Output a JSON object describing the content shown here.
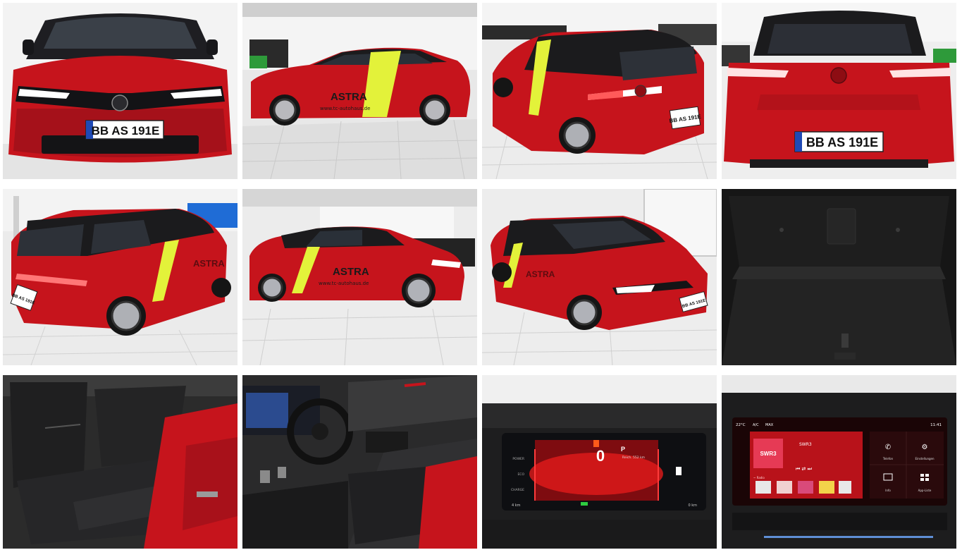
{
  "gallery": {
    "photos": [
      {
        "plate": "BB AS 191E"
      },
      {
        "door_text": "ASTRA",
        "door_url": "www.tc-autohaus.de",
        "stripe_text": "de"
      },
      {
        "plate": "BB AS 191E",
        "stripe_text": "de"
      },
      {
        "plate": "BB AS 191E"
      },
      {
        "door_text": "ASTRA",
        "plate": "BB AS 191E"
      },
      {
        "door_text": "ASTRA",
        "door_url": "www.tc-autohaus.de"
      },
      {
        "door_text": "ASTRA",
        "plate": "BB AS 191E"
      },
      {},
      {},
      {},
      {
        "speed": "0",
        "gear": "P",
        "range_label": "Reich. 552 km",
        "left_labels": [
          "POWER",
          "ECO",
          "CHARGE"
        ],
        "bottom_left": "4 km",
        "bottom_right": "0 km"
      },
      {
        "temp": "22°C",
        "climate": [
          "A/C",
          "MAX"
        ],
        "clock": "11:41",
        "station_logo": "SWR3",
        "station_name": "SWR3",
        "radio_sub": "~ Radio",
        "tiles": [
          {
            "icon": "phone-icon",
            "label": "Telefon"
          },
          {
            "icon": "gear-icon",
            "label": "Einstellungen"
          },
          {
            "icon": "media-icon",
            "label": "Info"
          },
          {
            "icon": "apps-icon",
            "label": "App-Liste"
          }
        ]
      }
    ]
  },
  "colors": {
    "car_red": "#c6141c",
    "car_red_dark": "#8d0d13",
    "roof_black": "#1b1b1d",
    "stripe_yellow": "#e3f23a",
    "floor": "#ebebeb",
    "screen_red": "#e21a1a"
  }
}
